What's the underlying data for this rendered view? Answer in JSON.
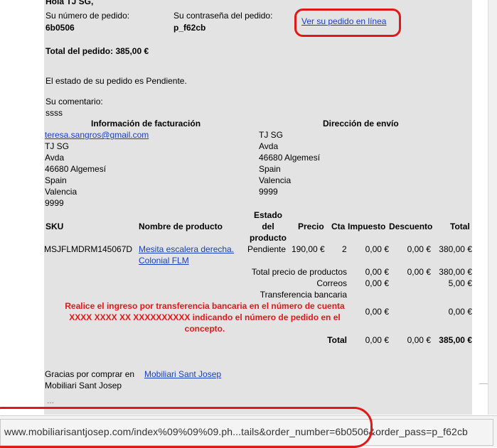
{
  "greeting": "Hola TJ SG,",
  "order": {
    "number_label": "Su número de pedido:",
    "number": "6b0506",
    "password_label": "Su contraseña del pedido:",
    "password": "p_f62cb",
    "view_link": "Ver su pedido en línea",
    "total_label": "Total del pedido: 385,00 €",
    "status_text": "El estado de su pedido es Pendiente.",
    "comment_label": "Su comentario:",
    "comment": "ssss"
  },
  "billing": {
    "title": "Información de facturación",
    "email": "teresa.sangros@gmail.com",
    "lines": [
      "TJ SG",
      "Avda",
      "46680 Algemesí",
      "Spain",
      "Valencia",
      "9999"
    ]
  },
  "shipping": {
    "title": "Dirección de envío",
    "lines": [
      "TJ SG",
      "Avda",
      "46680 Algemesí",
      "Spain",
      "Valencia",
      "9999"
    ]
  },
  "table": {
    "headers": {
      "sku": "SKU",
      "name": "Nombre de producto",
      "status1": "Estado",
      "status2": "del",
      "status3": "producto",
      "price": "Precio",
      "qty": "Cta",
      "tax": "Impuesto",
      "discount": "Descuento",
      "total": "Total"
    },
    "row": {
      "sku": "MSJFLMDRM145067D",
      "name1": "Mesita escalera derecha.",
      "name2": "Colonial FLM",
      "status": "Pendiente",
      "price": "190,00 €",
      "qty": "2",
      "tax": "0,00 €",
      "discount": "0,00 €",
      "total": "380,00 €"
    },
    "subtotal": {
      "label": "Total precio de productos",
      "tax": "0,00 €",
      "discount": "0,00 €",
      "total": "380,00 €"
    },
    "shipping": {
      "label": "Correos",
      "tax": "0,00 €",
      "total": "5,00 €"
    },
    "payment": {
      "label": "Transferencia bancaria",
      "note": "Realice el ingreso por transferencia bancaria en el número de cuenta XXXX XXXX XX XXXXXXXXXX indicando el número de pedido en el concepto.",
      "tax": "0,00 €",
      "total": "0,00 €"
    },
    "grand": {
      "label": "Total",
      "tax": "0,00 €",
      "discount": "0,00 €",
      "total": "385,00 €"
    }
  },
  "thanks": "Gracias por comprar en",
  "shop_link": "Mobiliari Sant Josep",
  "signature": "Mobiliari Sant Josep",
  "ellipsis": "...",
  "status_url": "www.mobiliarisantjosep.com/index%09%09%09.ph...tails&order_number=6b0506&order_pass=p_f62cb",
  "colors": {
    "highlight": "#e01818",
    "link": "#1a3fbf",
    "mail_bg": "#e3e3e3"
  }
}
